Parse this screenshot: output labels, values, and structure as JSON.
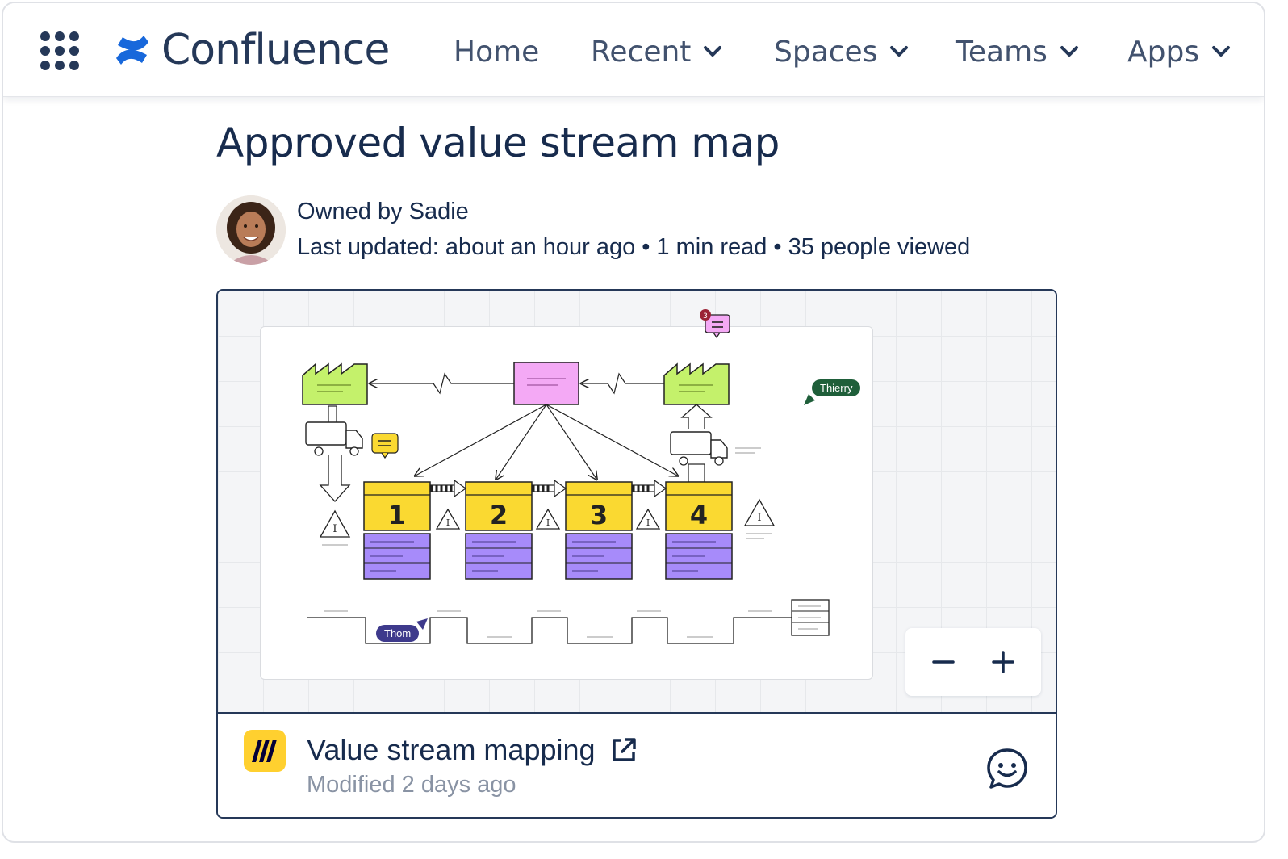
{
  "nav": {
    "brand": "Confluence",
    "items": [
      {
        "label": "Home"
      },
      {
        "label": "Recent"
      },
      {
        "label": "Spaces"
      },
      {
        "label": "Teams"
      },
      {
        "label": "Apps"
      }
    ],
    "brand_color": "#1868DB"
  },
  "page": {
    "title": "Approved value stream map",
    "owner": "Owned by Sadie",
    "last_updated": "Last updated: about an hour ago",
    "read_time": "1 min read",
    "views": "35 people viewed"
  },
  "embed": {
    "board": {
      "steps": [
        "1",
        "2",
        "3",
        "4"
      ],
      "comment_count": "3",
      "collaborators": [
        {
          "name": "Thierry",
          "color": "#1F5F3A"
        },
        {
          "name": "Thom",
          "color": "#3E3A8C"
        }
      ],
      "colors": {
        "factory": "#C4F16B",
        "customer": "#F4A9F5",
        "process": "#FAD931",
        "data": "#A78BFA"
      }
    },
    "title": "Value stream mapping",
    "modified": "Modified 2 days ago",
    "app_icon": "miro-icon"
  }
}
